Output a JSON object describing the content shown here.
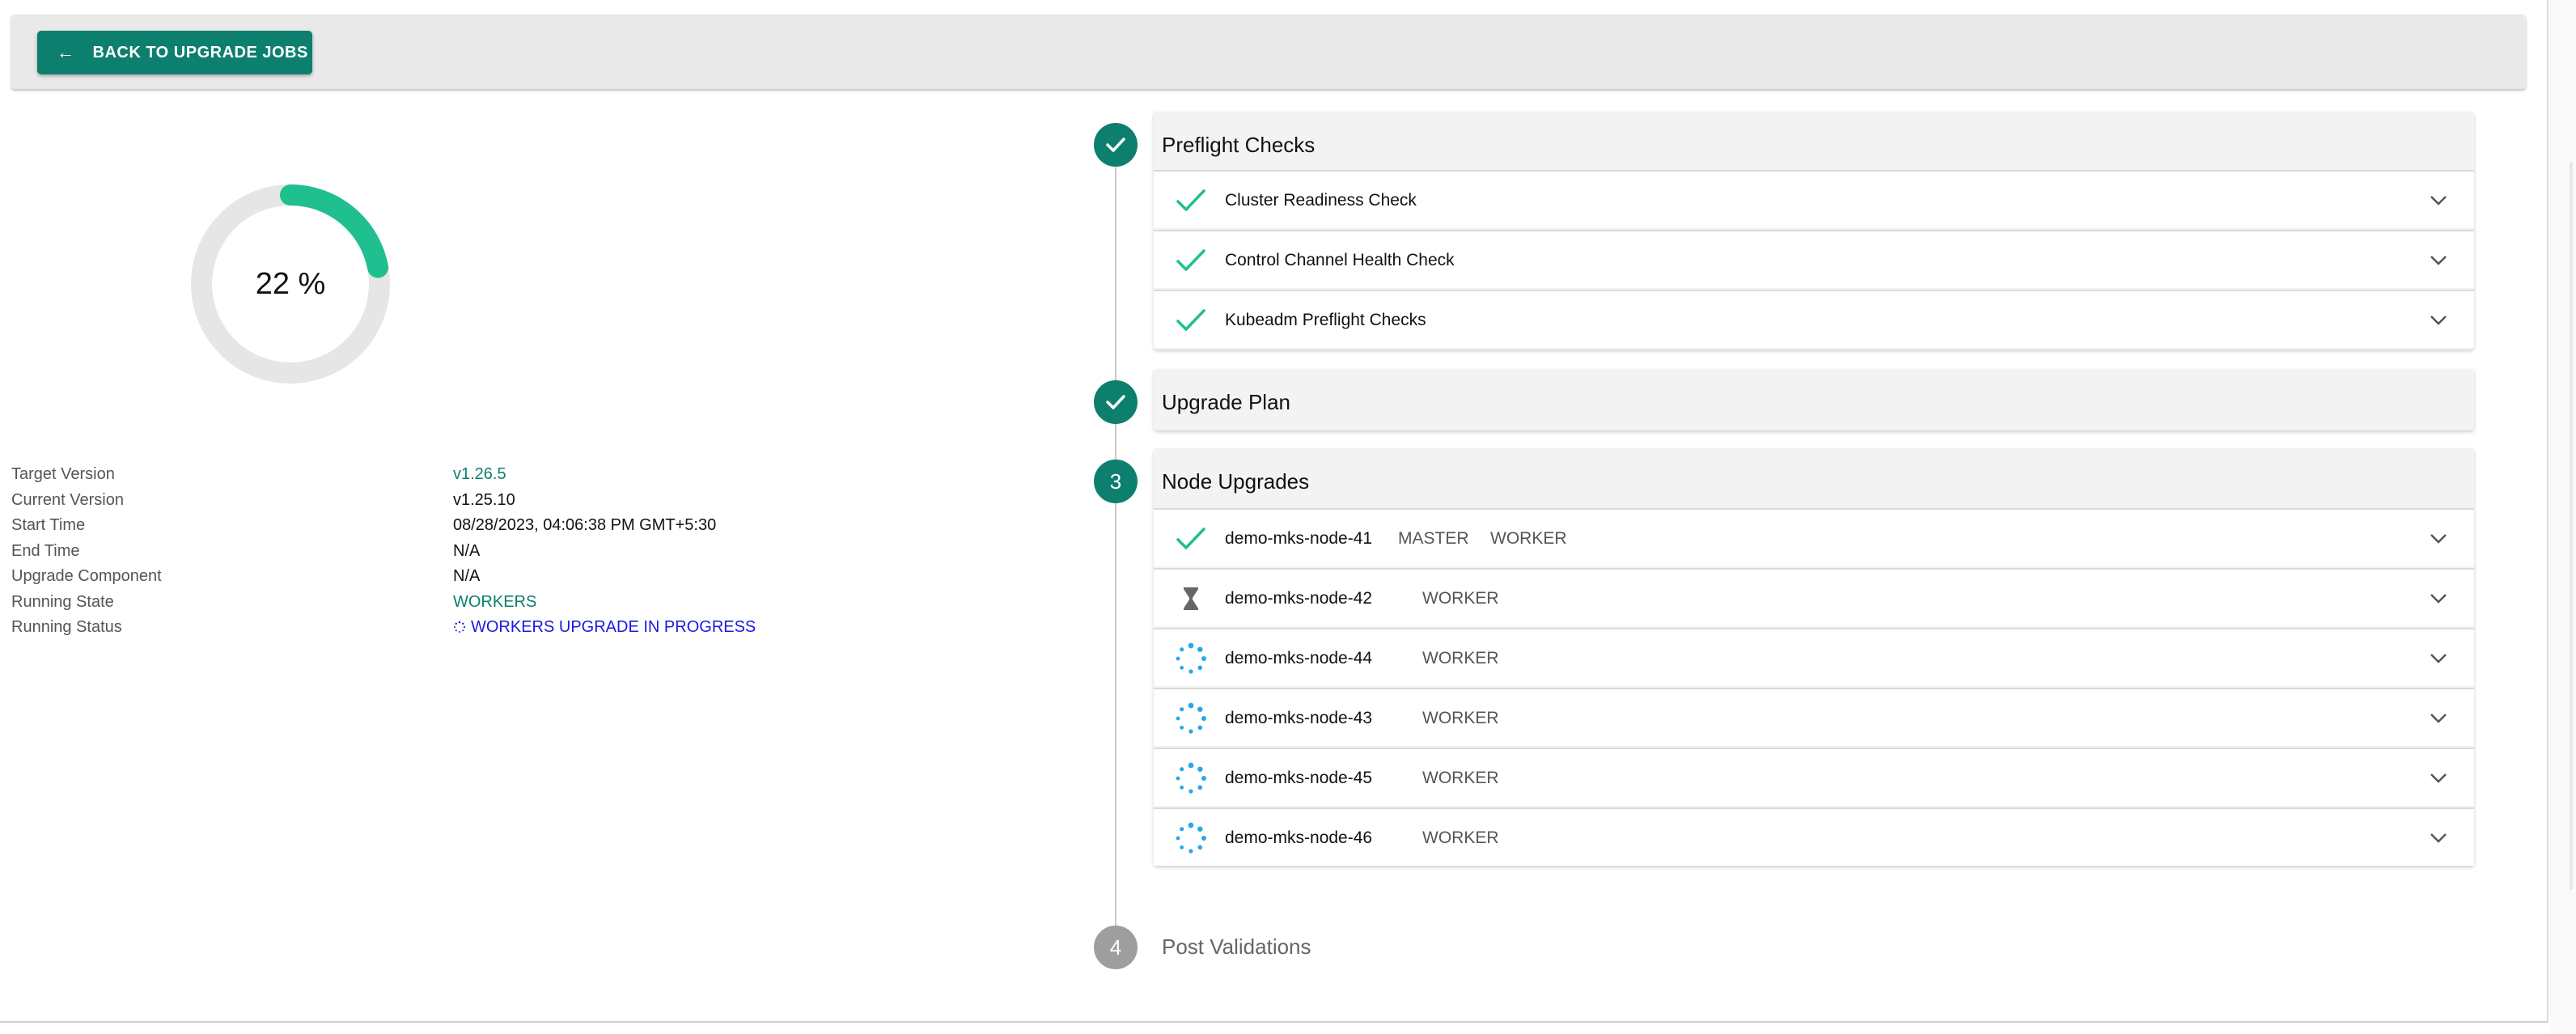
{
  "header": {
    "back_label": "BACK TO UPGRADE JOBS",
    "back_icon": "arrow-left-icon"
  },
  "progress": {
    "label": "22 %",
    "fraction": 0.22,
    "accent": "#1fbf8f",
    "track": "#e6e6e6"
  },
  "info": [
    {
      "key": "Target Version",
      "value": "v1.26.5"
    },
    {
      "key": "Current Version",
      "value": "v1.25.10"
    },
    {
      "key": "Start Time",
      "value": "08/28/2023, 04:06:38 PM GMT+5:30"
    },
    {
      "key": "End Time",
      "value": "N/A"
    },
    {
      "key": "Upgrade Component",
      "value": "N/A"
    },
    {
      "key": "Running State",
      "value": "WORKERS"
    },
    {
      "key": "Running Status",
      "value": "WORKERS UPGRADE IN PROGRESS"
    }
  ],
  "steps": {
    "preflight": {
      "title": "Preflight Checks",
      "status_icon": "check-icon",
      "items": [
        {
          "label": "Cluster Readiness Check",
          "icon": "check-icon"
        },
        {
          "label": "Control Channel Health Check",
          "icon": "check-icon"
        },
        {
          "label": "Kubeadm Preflight Checks",
          "icon": "check-icon"
        }
      ]
    },
    "plan": {
      "title": "Upgrade Plan",
      "status_icon": "check-icon"
    },
    "nodes": {
      "title": "Node Upgrades",
      "number": "3",
      "items": [
        {
          "label": "demo-mks-node-41",
          "tags": [
            "MASTER",
            "WORKER"
          ],
          "icon": "check-icon"
        },
        {
          "label": "demo-mks-node-42",
          "tags": [
            "WORKER"
          ],
          "icon": "hourglass-icon"
        },
        {
          "label": "demo-mks-node-44",
          "tags": [
            "WORKER"
          ],
          "icon": "spinner-icon"
        },
        {
          "label": "demo-mks-node-43",
          "tags": [
            "WORKER"
          ],
          "icon": "spinner-icon"
        },
        {
          "label": "demo-mks-node-45",
          "tags": [
            "WORKER"
          ],
          "icon": "spinner-icon"
        },
        {
          "label": "demo-mks-node-46",
          "tags": [
            "WORKER"
          ],
          "icon": "spinner-icon"
        }
      ]
    },
    "post": {
      "title": "Post Validations",
      "number": "4"
    }
  },
  "colors": {
    "brand": "#0d7f6f",
    "check": "#1fbf8f",
    "spinner": "#29a8e8",
    "status_blue": "#1a1ae0"
  }
}
